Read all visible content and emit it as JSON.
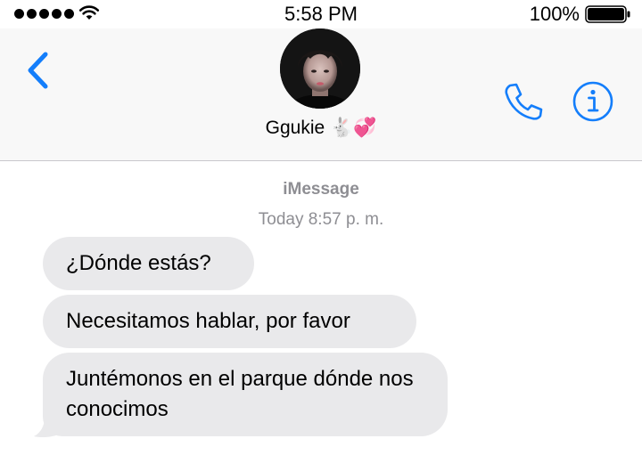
{
  "status_bar": {
    "time": "5:58 PM",
    "battery_percent": "100%",
    "signal_bars": 5,
    "signal_icon": "signal-dots-icon",
    "wifi_icon": "wifi-icon",
    "battery_icon": "battery-full-icon"
  },
  "header": {
    "back_icon": "chevron-left-icon",
    "contact_name": "Ggukie 🐇💞",
    "call_icon": "phone-icon",
    "info_icon": "info-icon"
  },
  "conversation": {
    "service": "iMessage",
    "timestamp": "Today 8:57 p. m.",
    "messages": [
      {
        "direction": "incoming",
        "text": "¿Dónde estás?"
      },
      {
        "direction": "incoming",
        "text": "Necesitamos hablar, por favor"
      },
      {
        "direction": "incoming",
        "text": "Juntémonos en el parque dónde nos conocimos"
      }
    ]
  },
  "colors": {
    "accent": "#147efb",
    "incoming_bubble": "#e9e9eb",
    "meta_text": "#8e8e93",
    "header_bg": "#f8f8f8"
  }
}
